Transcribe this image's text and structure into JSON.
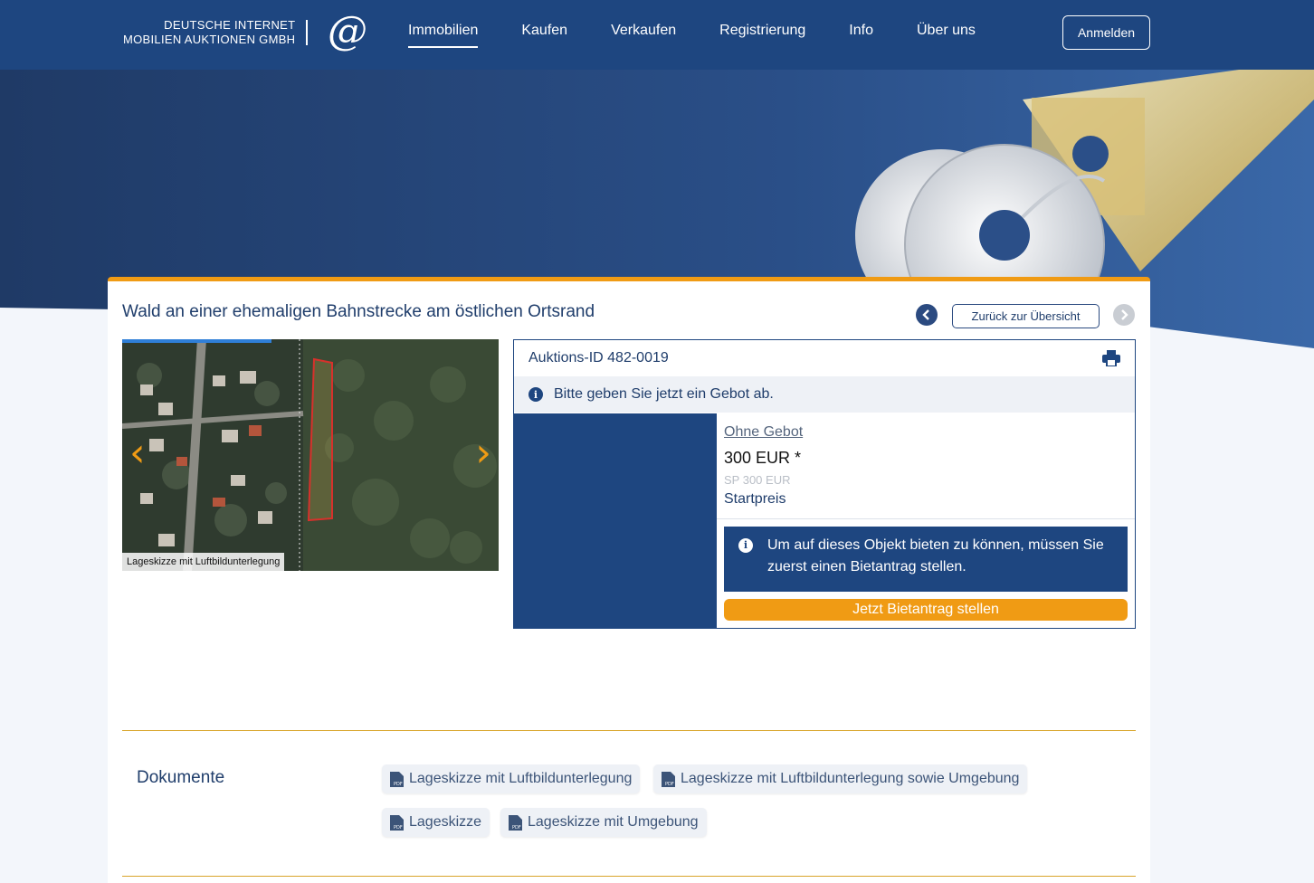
{
  "header": {
    "logo_line1": "DEUTSCHE INTERNET",
    "logo_line2": "MOBILIEN AUKTIONEN GMBH",
    "logo_mark": "@",
    "nav": [
      {
        "label": "Immobilien",
        "active": true
      },
      {
        "label": "Kaufen"
      },
      {
        "label": "Verkaufen"
      },
      {
        "label": "Registrierung"
      },
      {
        "label": "Info"
      },
      {
        "label": "Über uns"
      }
    ],
    "login_label": "Anmelden"
  },
  "listing": {
    "title": "Wald an einer ehemaligen Bahnstrecke am östlichen Ortsrand",
    "back_label": "Zurück zur Übersicht",
    "prev_icon": "chevron-left-icon",
    "next_icon": "chevron-right-icon",
    "gallery": {
      "caption": "Lageskizze mit Luftbildunterlegung",
      "prev_arrow": "‹",
      "next_arrow": "›"
    }
  },
  "auction": {
    "id_label": "Auktions-ID 482-0019",
    "hint": "Bitte geben Sie jetzt ein Gebot ab.",
    "bid_status": "Ohne Gebot",
    "price": "300 EUR *",
    "sp": "SP 300 EUR",
    "price_label": "Startpreis",
    "notice": "Um auf dieses Objekt bieten zu können, müssen Sie zuerst einen Bietantrag stellen.",
    "cta_label": "Jetzt Bietantrag stellen"
  },
  "documents": {
    "title": "Dokumente",
    "items": [
      "Lageskizze mit Luftbildunterlegung",
      "Lageskizze mit Luftbildunterlegung sowie Umgebung",
      "Lageskizze",
      "Lageskizze mit Umgebung"
    ]
  },
  "colors": {
    "primary": "#1e4680",
    "accent": "#f09b14",
    "divider": "#d9a52b"
  }
}
